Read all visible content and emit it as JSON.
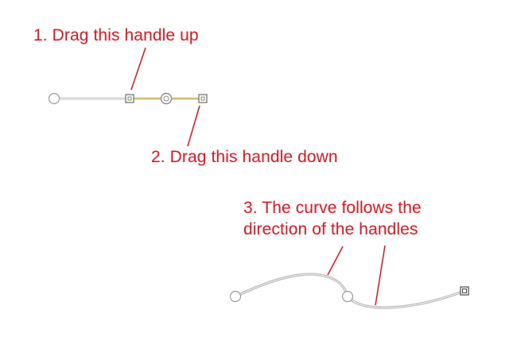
{
  "annotations": {
    "step1": "1. Drag this handle up",
    "step2": "2. Drag this handle down",
    "step3_line1": "3. The curve follows the",
    "step3_line2": "direction of the handles"
  },
  "colors": {
    "annotation": "#e6141e",
    "path_stroke": "#b8b8b8",
    "handle_line": "#c8a84a",
    "point_fill": "#ffffff",
    "point_stroke": "#9a9a9a"
  }
}
